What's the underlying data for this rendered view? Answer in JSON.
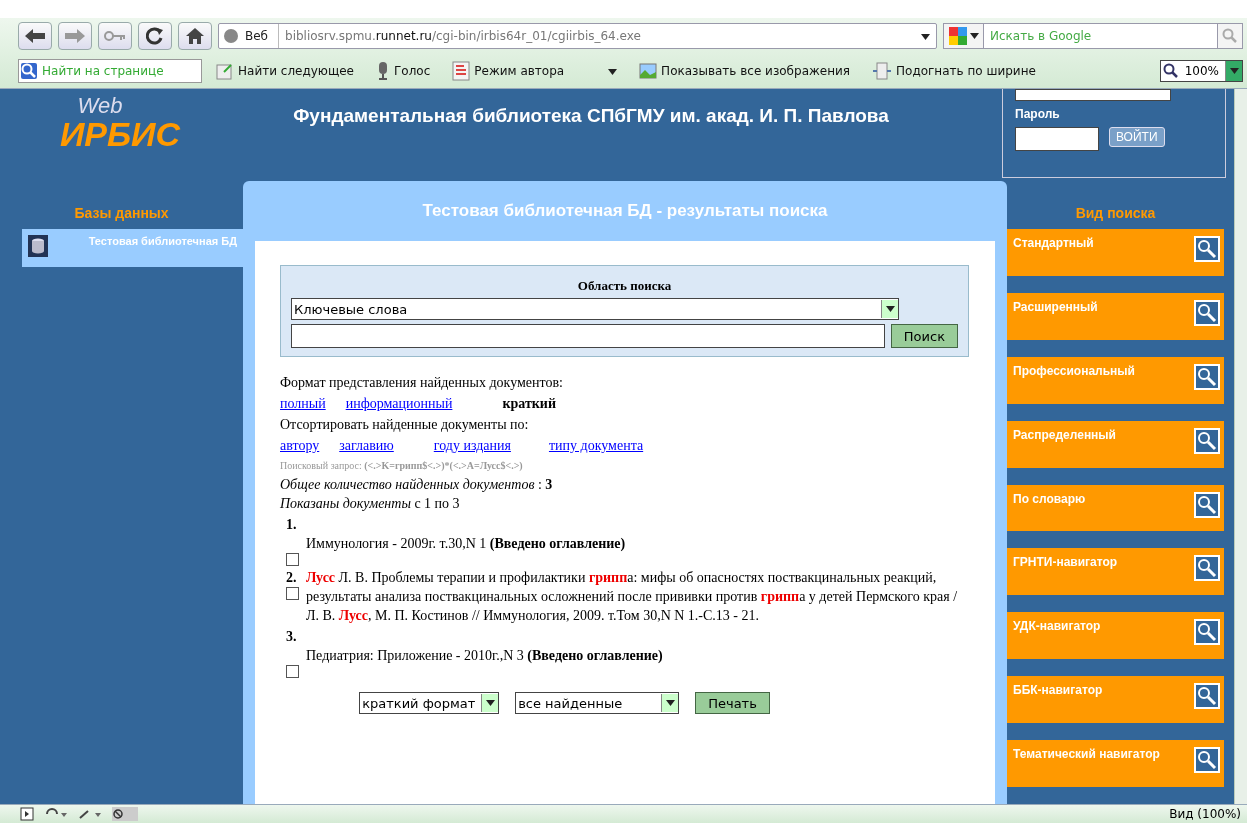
{
  "browser": {
    "address_label": "Веб",
    "url": "bibliosrv.spmu.**runnet.ru**/cgi-bin/irbis64r_01/cgiirbis_64.exe",
    "search_placeholder": "Искать в Google",
    "toolbar": [
      {
        "kind": "find",
        "label": "Найти на странице"
      },
      {
        "kind": "next",
        "label": "Найти следующее"
      },
      {
        "kind": "voice",
        "label": "Голос"
      },
      {
        "kind": "author",
        "label": "Режим автора"
      },
      {
        "kind": "images",
        "label": "Показывать все изображения"
      },
      {
        "kind": "fit",
        "label": "Подогнать по ширине"
      }
    ],
    "zoom": "100%",
    "status_zoom": "Вид (100%)"
  },
  "site": {
    "logo_top": "Web",
    "logo_main": "ИРБИС",
    "title": "Фундаментальная библиотека СПбГМУ им. акад. И. П. Павлова",
    "password_label": "Пароль",
    "login_button": "ВОЙТИ"
  },
  "databases": {
    "heading": "Базы данных",
    "items": [
      {
        "label": "Тестовая библиотечная БД",
        "selected": true
      }
    ]
  },
  "panel": {
    "title": "Тестовая библиотечная БД - результаты поиска",
    "search_area": {
      "heading": "Область поиска",
      "field": "Ключевые слова",
      "button": "Поиск"
    },
    "format_label": "Формат представления найденных документов:",
    "formats": [
      {
        "label": "полный",
        "selected": false
      },
      {
        "label": "информационный",
        "selected": false
      },
      {
        "label": "краткий",
        "selected": true
      }
    ],
    "sort_label": "Отсортировать найденные документы по:",
    "sorts": [
      "автору",
      "заглавию",
      "году издания",
      "типу документа"
    ],
    "query": "Поисковый запрос: **(<.>K=грипп$<.>)*(<.>A=Лусс$<.>)**",
    "total": "*Общее количество найденных документов* : **3**",
    "shown": "*Показаны документы* с 1 по 3",
    "records": [
      {
        "number": "1.",
        "checked": false,
        "segments": [
          {
            "text": "Иммунология - 2009г. т.30,N 1 **(Введено оглавление)**",
            "highlight": false
          }
        ]
      },
      {
        "number": "2.",
        "checked": false,
        "segments": [
          {
            "text": "Лусс",
            "highlight": true
          },
          {
            "text": " Л. В. Проблемы терапии и профилактики ",
            "highlight": false
          },
          {
            "text": "грипп",
            "highlight": true
          },
          {
            "text": "а: мифы об опасностях поствакцинальных реакций, результаты анализа поствакцинальных осложнений после прививки против ",
            "highlight": false
          },
          {
            "text": "грипп",
            "highlight": true
          },
          {
            "text": "а у детей Пермского края /Л. В. ",
            "highlight": false
          },
          {
            "text": "Лусс",
            "highlight": true
          },
          {
            "text": ", М. П. Костинов // Иммунология, 2009. т.Том 30,N N 1.-С.13 - 21.",
            "highlight": false
          }
        ]
      },
      {
        "number": "3.",
        "checked": false,
        "segments": [
          {
            "text": "Педиатрия: Приложение - 2010г.,N 3 **(Введено оглавление)**",
            "highlight": false
          }
        ]
      }
    ],
    "print_format": "краткий формат",
    "print_scope": "все найденные",
    "print_button": "Печать"
  },
  "search_types": {
    "heading": "Вид поиска",
    "items": [
      "Стандартный",
      "Расширенный",
      "Профессиональный",
      "Распределенный",
      "По словарю",
      "ГРНТИ-навигатор",
      "УДК-навигатор",
      "ББК-навигатор",
      "Тематический навигатор"
    ]
  }
}
